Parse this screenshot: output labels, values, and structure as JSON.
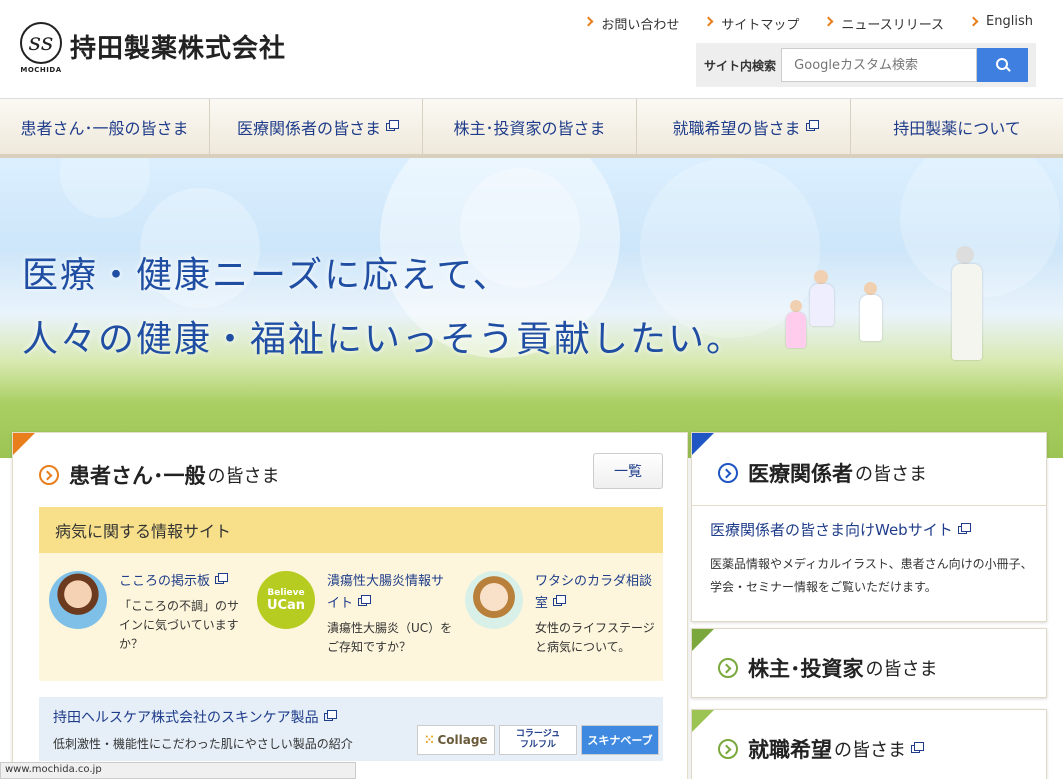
{
  "header": {
    "logo_small": "MOCHIDA",
    "company_name": "持田製薬株式会社",
    "utility_links": [
      "お問い合わせ",
      "サイトマップ",
      "ニュースリリース",
      "English"
    ],
    "search_label": "サイト内検索",
    "search_placeholder": "Googleカスタム検索"
  },
  "nav": [
    "患者さん･一般の皆さま",
    "医療関係者の皆さま",
    "株主･投資家の皆さま",
    "就職希望の皆さま",
    "持田製薬について"
  ],
  "hero": {
    "line1": "医療・健康ニーズに応えて、",
    "line2": "人々の健康・福祉にいっそう貢献したい。"
  },
  "patients": {
    "title_bold": "患者さん･一般",
    "title_small": "の皆さま",
    "list_button": "一覧",
    "info_heading": "病気に関する情報サイト",
    "sites": [
      {
        "title": "こころの掲示板",
        "desc": "「こころの不調」のサインに気づいていますか？"
      },
      {
        "title": "潰瘍性大腸炎情報サイト",
        "desc": "潰瘍性大腸炎（UC）をご存知ですか？"
      },
      {
        "title": "ワタシのカラダ相談室",
        "desc": "女性のライフステージと病気について。"
      }
    ],
    "ucan_top": "Believe",
    "ucan_bottom": "UCan",
    "skin_title": "持田ヘルスケア株式会社のスキンケア製品",
    "skin_desc": "低刺激性・機能性にこだわった肌にやさしい製品の紹介",
    "brands": [
      "Collage",
      "コラージュ\nフルフル",
      "スキナベーブ"
    ]
  },
  "medical": {
    "title_bold": "医療関係者",
    "title_small": "の皆さま",
    "link": "医療関係者の皆さま向けWebサイト",
    "desc": "医薬品情報やメディカルイラスト、患者さん向けの小冊子、学会・セミナー情報をご覧いただけます。"
  },
  "investors": {
    "title_bold": "株主･投資家",
    "title_small": "の皆さま"
  },
  "careers": {
    "title_bold": "就職希望",
    "title_small": "の皆さま"
  },
  "status_bar": "www.mochida.co.jp",
  "colors": {
    "accent_orange": "#e87e1c",
    "nav_text": "#1f3d8a",
    "search_button": "#3f7fe0",
    "info_band": "#f8e08b",
    "skin_box": "#e6eff8"
  }
}
